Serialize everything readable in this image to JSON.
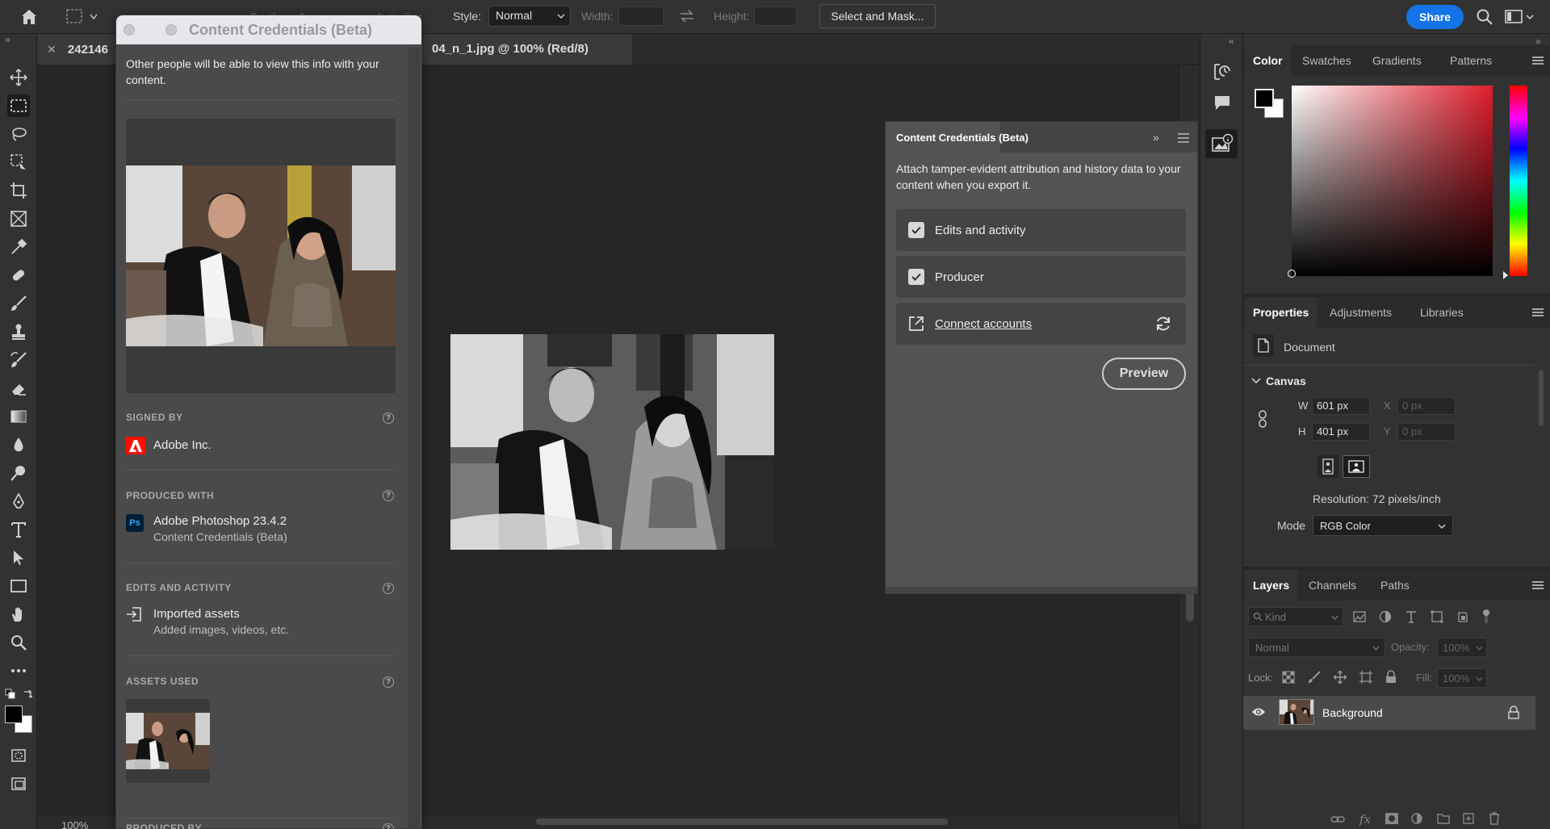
{
  "options_bar": {
    "feather_label": "Feather:",
    "feather_value": "0 px",
    "antialias_label": "Anti-alias",
    "style_label": "Style:",
    "style_value": "Normal",
    "width_label": "Width:",
    "height_label": "Height:",
    "select_mask_label": "Select and Mask...",
    "share_label": "Share"
  },
  "document_tab": {
    "title_left": "242146",
    "title_right": "04_n_1.jpg @ 100% (Red/8)"
  },
  "status": {
    "zoom": "100%"
  },
  "cc_panel": {
    "window_title": "Content Credentials (Beta)",
    "intro": "Other people will be able to view this info with your content.",
    "signed_by_title": "SIGNED BY",
    "signed_by_value": "Adobe Inc.",
    "produced_with_title": "PRODUCED WITH",
    "produced_with_app": "Adobe Photoshop 23.4.2",
    "produced_with_plugin": "Content Credentials (Beta)",
    "edits_title": "EDITS AND ACTIVITY",
    "edits_item": "Imported assets",
    "edits_item_sub": "Added images, videos, etc.",
    "assets_title": "ASSETS USED",
    "produced_by_title": "PRODUCED BY",
    "help_glyph": "?"
  },
  "mid_panel": {
    "title": "Content Credentials (Beta)",
    "description": "Attach tamper-evident attribution and history data to your content when you export it.",
    "option_edits": "Edits and activity",
    "option_producer": "Producer",
    "connect_accounts": "Connect accounts",
    "preview_label": "Preview"
  },
  "color_panel": {
    "tabs": [
      "Color",
      "Swatches",
      "Gradients",
      "Patterns"
    ],
    "foreground": "#000000",
    "background": "#ffffff",
    "hue_color": "#e01d2c"
  },
  "properties_panel": {
    "tabs": [
      "Properties",
      "Adjustments",
      "Libraries"
    ],
    "document_label": "Document",
    "canvas_label": "Canvas",
    "w_label": "W",
    "w_value": "601 px",
    "h_label": "H",
    "h_value": "401 px",
    "x_label": "X",
    "x_placeholder": "0 px",
    "y_label": "Y",
    "y_placeholder": "0 px",
    "resolution": "Resolution: 72 pixels/inch",
    "mode_label": "Mode",
    "mode_value": "RGB Color"
  },
  "layers_panel": {
    "tabs": [
      "Layers",
      "Channels",
      "Paths"
    ],
    "kind_placeholder": "Kind",
    "blend_mode": "Normal",
    "opacity_label": "Opacity:",
    "opacity_value": "100%",
    "lock_label": "Lock:",
    "fill_label": "Fill:",
    "fill_value": "100%",
    "layer_name": "Background"
  }
}
